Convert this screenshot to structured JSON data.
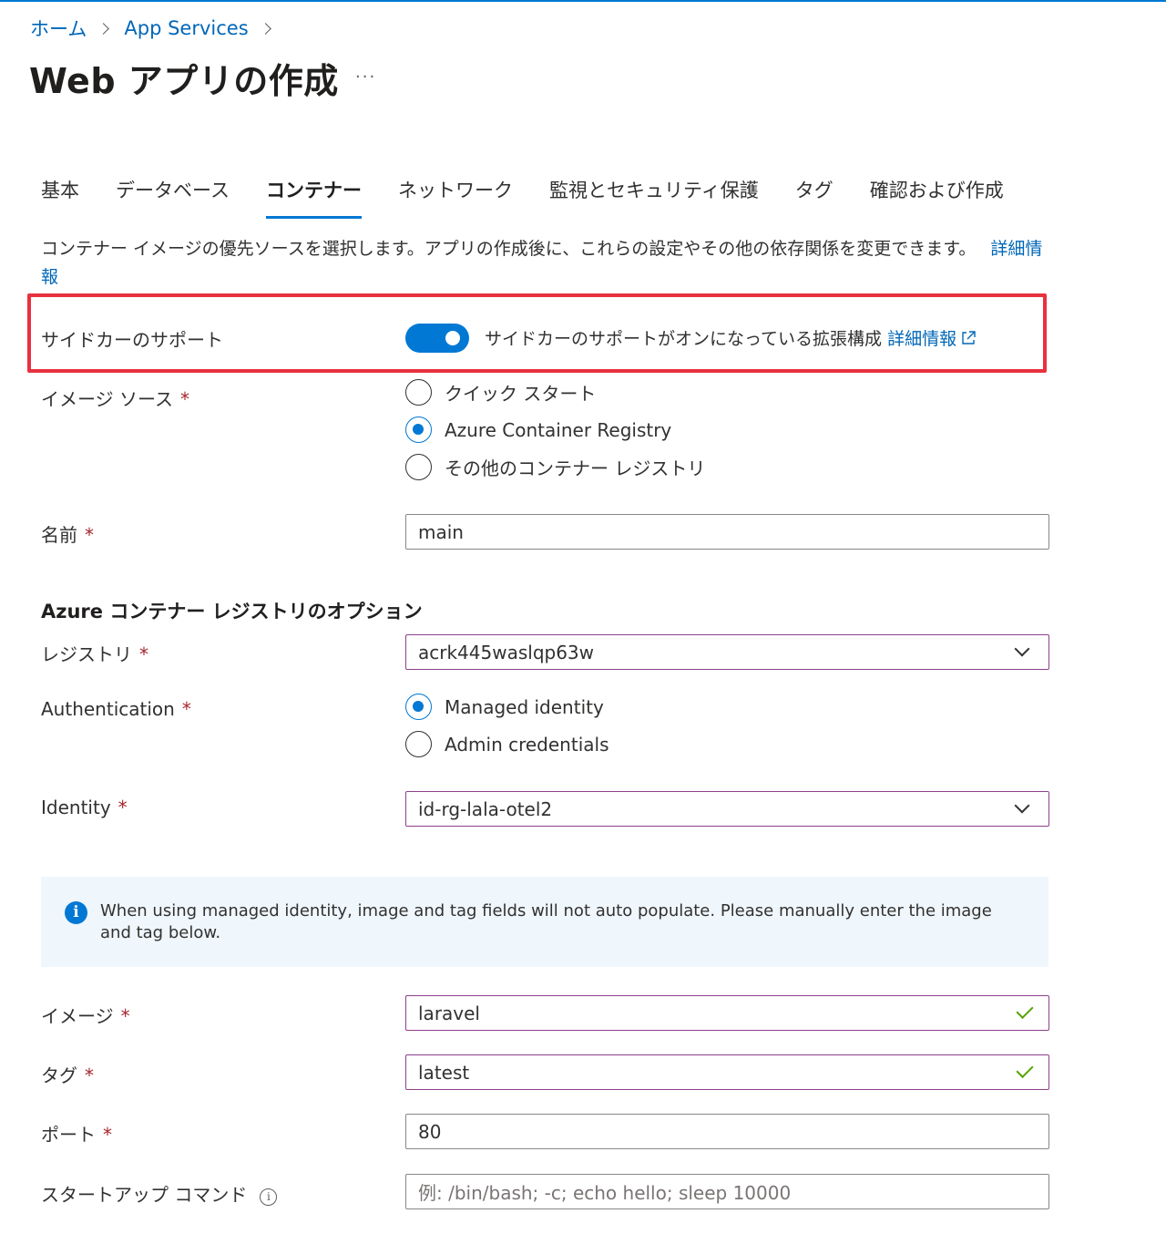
{
  "breadcrumb": {
    "home": "ホーム",
    "app_services": "App Services"
  },
  "page": {
    "title": "Web アプリの作成",
    "more": "···"
  },
  "tabs": [
    {
      "label": "基本",
      "active": false
    },
    {
      "label": "データベース",
      "active": false
    },
    {
      "label": "コンテナー",
      "active": true
    },
    {
      "label": "ネットワーク",
      "active": false
    },
    {
      "label": "監視とセキュリティ保護",
      "active": false
    },
    {
      "label": "タグ",
      "active": false
    },
    {
      "label": "確認および作成",
      "active": false
    }
  ],
  "description": {
    "text": "コンテナー イメージの優先ソースを選択します。アプリの作成後に、これらの設定やその他の依存関係を変更できます。",
    "link": "詳細情報"
  },
  "sidecar": {
    "label": "サイドカーのサポート",
    "toggle_on": true,
    "text": "サイドカーのサポートがオンになっている拡張構成",
    "link": "詳細情報"
  },
  "image_source": {
    "label": "イメージ ソース",
    "required": "*",
    "options": [
      "クイック スタート",
      "Azure Container Registry",
      "その他のコンテナー レジストリ"
    ],
    "selected": "Azure Container Registry"
  },
  "name": {
    "label": "名前",
    "required": "*",
    "value": "main"
  },
  "acr_section": {
    "title": "Azure コンテナー レジストリのオプション"
  },
  "registry": {
    "label": "レジストリ",
    "required": "*",
    "value": "acrk445waslqp63w"
  },
  "authentication": {
    "label": "Authentication",
    "required": "*",
    "options": [
      "Managed identity",
      "Admin credentials"
    ],
    "selected": "Managed identity"
  },
  "identity": {
    "label": "Identity",
    "required": "*",
    "value": "id-rg-lala-otel2"
  },
  "info_banner": {
    "icon": "info-icon",
    "text": "When using managed identity, image and tag fields will not auto populate. Please manually enter the image and tag below."
  },
  "image": {
    "label": "イメージ",
    "required": "*",
    "value": "laravel"
  },
  "tag": {
    "label": "タグ",
    "required": "*",
    "value": "latest"
  },
  "port": {
    "label": "ポート",
    "required": "*",
    "value": "80"
  },
  "startup": {
    "label": "スタートアップ コマンド",
    "placeholder": "例: /bin/bash; -c; echo hello; sleep 10000"
  },
  "colors": {
    "accent": "#0078d4",
    "link": "#0067b8",
    "highlight": "#e8313f",
    "required": "#a4262c",
    "valid": "#57a300"
  }
}
